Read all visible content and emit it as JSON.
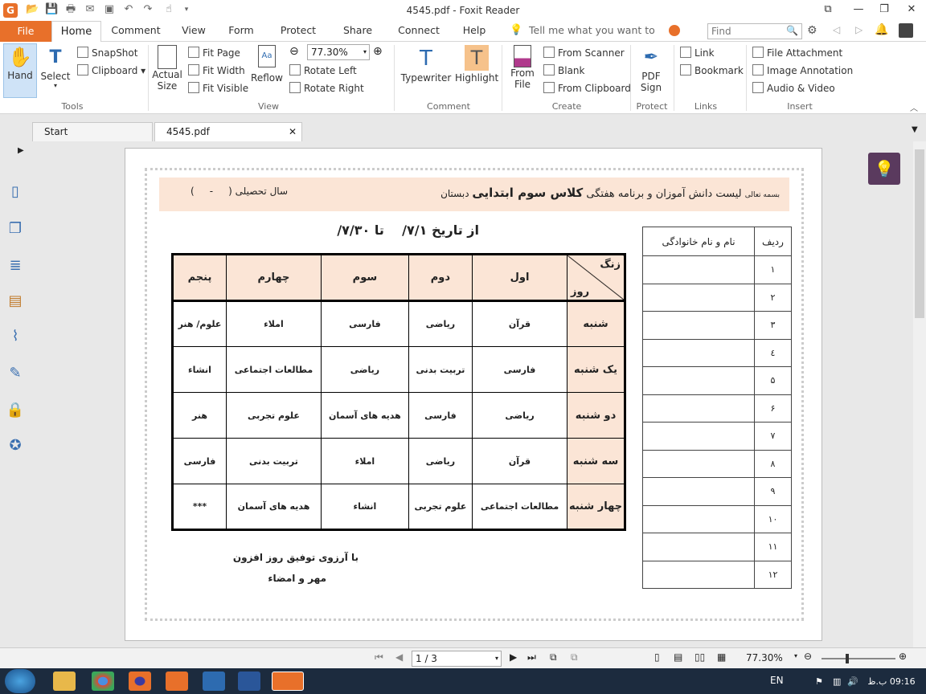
{
  "window": {
    "title": "4545.pdf - Foxit Reader"
  },
  "menu_tabs": [
    "File",
    "Home",
    "Comment",
    "View",
    "Form",
    "Protect",
    "Share",
    "Connect",
    "Help"
  ],
  "tell_me": "Tell me what you want to do...",
  "find_placeholder": "Find",
  "ribbon": {
    "tools": {
      "hand": "Hand",
      "select": "Select",
      "snapshot": "SnapShot",
      "clipboard": "Clipboard",
      "group": "Tools"
    },
    "view": {
      "actual_size": "Actual Size",
      "fit_page": "Fit Page",
      "fit_width": "Fit Width",
      "fit_visible": "Fit Visible",
      "reflow": "Reflow",
      "zoom": "77.30%",
      "rotate_left": "Rotate Left",
      "rotate_right": "Rotate Right",
      "group": "View"
    },
    "comment": {
      "typewriter": "Typewriter",
      "highlight": "Highlight",
      "group": "Comment"
    },
    "create": {
      "from_file": "From File",
      "from_scanner": "From Scanner",
      "blank": "Blank",
      "from_clipboard": "From Clipboard",
      "group": "Create"
    },
    "protect": {
      "pdf_sign": "PDF Sign",
      "group": "Protect"
    },
    "links": {
      "link": "Link",
      "bookmark": "Bookmark",
      "group": "Links"
    },
    "insert": {
      "file_attachment": "File Attachment",
      "image_annotation": "Image Annotation",
      "audio_video": "Audio & Video",
      "group": "Insert"
    }
  },
  "doc_tabs": [
    "Start",
    "4545.pdf"
  ],
  "document": {
    "header_right_small": "بسمه تعالی",
    "header_right_title_a": "لیست دانش آموزان و برنامه هفتگی ",
    "header_right_title_b": "کلاس سوم ابتدایی",
    "header_right_title_c": " دبستان",
    "header_left": "سال تحصیلی (     -     )",
    "date_line": "از تاریخ ۷/۱/    تا ۷/۳۰/",
    "corner_top": "زنگ",
    "corner_bottom": "روز",
    "periods": [
      "اول",
      "دوم",
      "سوم",
      "چهارم",
      "پنجم"
    ],
    "days": [
      {
        "day": "شنبه",
        "classes": [
          "قرآن",
          "ریاضی",
          "فارسی",
          "املاء",
          "علوم/ هنر"
        ]
      },
      {
        "day": "یک شنبه",
        "classes": [
          "فارسی",
          "تربیت بدنی",
          "ریاضی",
          "مطالعات اجتماعی",
          "انشاء"
        ]
      },
      {
        "day": "دو شنبه",
        "classes": [
          "ریاضی",
          "فارسی",
          "هدیه های آسمان",
          "علوم تجربی",
          "هنر"
        ]
      },
      {
        "day": "سه شنبه",
        "classes": [
          "قرآن",
          "ریاضی",
          "املاء",
          "تربیت بدنی",
          "فارسی"
        ]
      },
      {
        "day": "چهار شنبه",
        "classes": [
          "مطالعات اجتماعی",
          "علوم تجربی",
          "انشاء",
          "هدیه های آسمان",
          "***"
        ]
      }
    ],
    "footer_line1": "با آرزوی توفیق روز افزون",
    "footer_line2": "مهر و امضاء",
    "names_table": {
      "col_row": "ردیف",
      "col_name": "نام و نام خانوادگی",
      "rows": [
        "۱",
        "۲",
        "۳",
        "٤",
        "۵",
        "۶",
        "۷",
        "۸",
        "۹",
        "۱۰",
        "۱۱",
        "۱۲"
      ]
    }
  },
  "status": {
    "page": "1 / 3",
    "zoom": "77.30%"
  },
  "taskbar": {
    "lang": "EN",
    "time": "09:16 ب.ظ"
  }
}
